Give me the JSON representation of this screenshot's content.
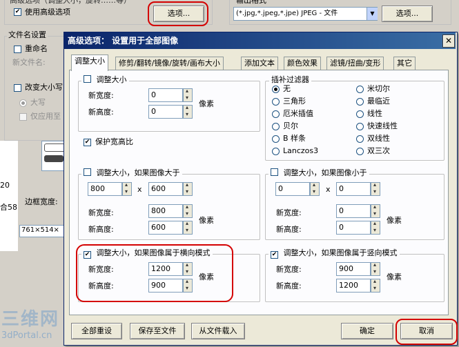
{
  "bg": {
    "top_group_title": "高级选项（调整大小，旋转……等）",
    "use_advanced_label": "使用高级选项",
    "options_button_1": "选项...",
    "output_format_title": "输出格式",
    "output_format_value": "(*.jpg,*.jpeg,*.jpe) JPEG - 文件",
    "options_button_2": "选项...",
    "filename_settings_title": "文件名设置",
    "rename_label": "重命名",
    "new_filename_label": "新文件名:",
    "change_case_label": "改变大小写",
    "uppercase_label": "大写",
    "apply_only_label": "仅应用至",
    "border_width_label": "边框宽度:",
    "dims_readout": "761×514×",
    "left_num_1": "20",
    "left_num_2": "合58"
  },
  "dialog": {
    "title": "高级选项： 设置用于全部图像",
    "tabs": [
      {
        "label": "调整大小"
      },
      {
        "label": "修剪/翻转/镜像/旋转/画布大小"
      },
      {
        "label": "添加文本"
      },
      {
        "label": "颜色效果"
      },
      {
        "label": "滤镜/扭曲/变形"
      },
      {
        "label": "其它"
      }
    ],
    "resize": {
      "title": "调整大小",
      "new_width_label": "新宽度:",
      "new_width": "0",
      "new_height_label": "新高度:",
      "new_height": "0",
      "unit": "像素",
      "keep_ratio_label": "保护宽高比"
    },
    "interp": {
      "title": "插补过滤器",
      "options": [
        "无",
        "三角形",
        "厄米插值",
        "贝尔",
        "B 样条",
        "Lanczos3",
        "米切尔",
        "最临近",
        "线性",
        "快速线性",
        "双线性",
        "双三次"
      ],
      "selected": "无"
    },
    "if_larger": {
      "title": "调整大小，如果图像大于",
      "w": "800",
      "x": "x",
      "h": "600",
      "new_width_label": "新宽度:",
      "new_width": "800",
      "new_height_label": "新高度:",
      "new_height": "600",
      "unit": "像素"
    },
    "if_smaller": {
      "title": "调整大小，如果图像小于",
      "w": "0",
      "x": "x",
      "h": "0",
      "new_width_label": "新宽度:",
      "new_width": "0",
      "new_height_label": "新高度:",
      "new_height": "0",
      "unit": "像素"
    },
    "landscape": {
      "title": "调整大小，如果图像属于横向模式",
      "new_width_label": "新宽度:",
      "new_width": "1200",
      "new_height_label": "新高度:",
      "new_height": "900",
      "unit": "像素"
    },
    "portrait": {
      "title": "调整大小，如果图像属于竖向模式",
      "new_width_label": "新宽度:",
      "new_width": "900",
      "new_height_label": "新高度:",
      "new_height": "1200",
      "unit": "像素"
    },
    "buttons": {
      "reset_all": "全部重设",
      "save_to_file": "保存至文件",
      "load_from_file": "从文件载入",
      "ok": "确定",
      "cancel": "取消"
    }
  },
  "watermark": {
    "line1": "三维网",
    "line2": "3dPortal.cn"
  },
  "colors": {
    "title_bar": "#0a246a",
    "highlight": "#d40000"
  }
}
